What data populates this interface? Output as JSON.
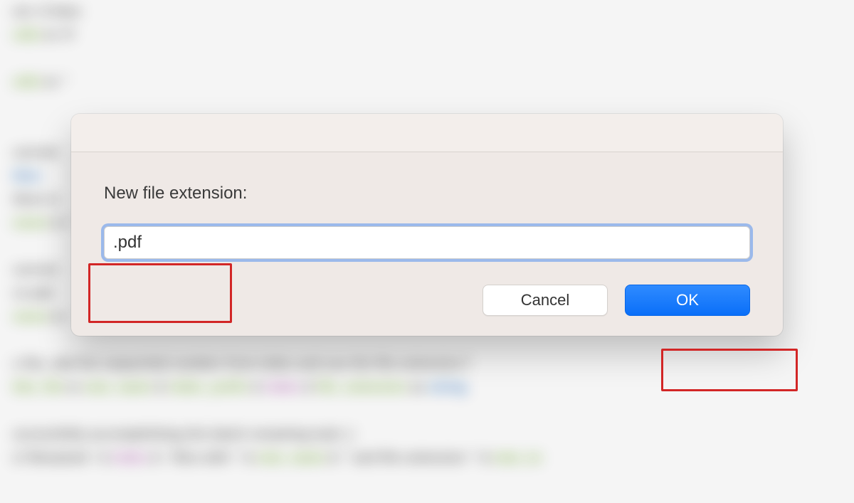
{
  "dialog": {
    "prompt": "New file extension:",
    "input_value": ".pdf",
    "cancel_label": "Cancel",
    "ok_label": "OK"
  },
  "background_code": {
    "l1": "ern :5 then",
    "l2_var": "refix",
    "l2b": " to '0'",
    "l3_var": "refix",
    "l3b": " to ''",
    "l4": "current",
    "l4b_kw": " then",
    "l5": "there is",
    "l6_var": "nsion",
    "l6b": " to ''",
    "l7": "current",
    "l8": "re-add",
    "l9_var": "nsion",
    "l9b": " to",
    "l10": "e file, add the sequential number from index and use the file extension f",
    "l11_var": "this_file",
    "l11b": " to ",
    "l11c_var": "new_name",
    "l11d": " & ",
    "l11e_var": "index_prefix",
    "l11f": " & ",
    "l11g_mag": "index",
    "l11h": " & ",
    "l11i_var": "file_extension",
    "l11j": " as ",
    "l11k_kw": "string",
    "l12": "uccessfully accomplishing the batch renaming task  :)",
    "l13a": "e! Renamed ' & ",
    "l13b_mag": "index",
    "l13c": " & ' files with '' & ",
    "l13d_var": "new_name",
    "l13e": " & '' and file extension '' & ",
    "l13f_var": "new_ex"
  }
}
